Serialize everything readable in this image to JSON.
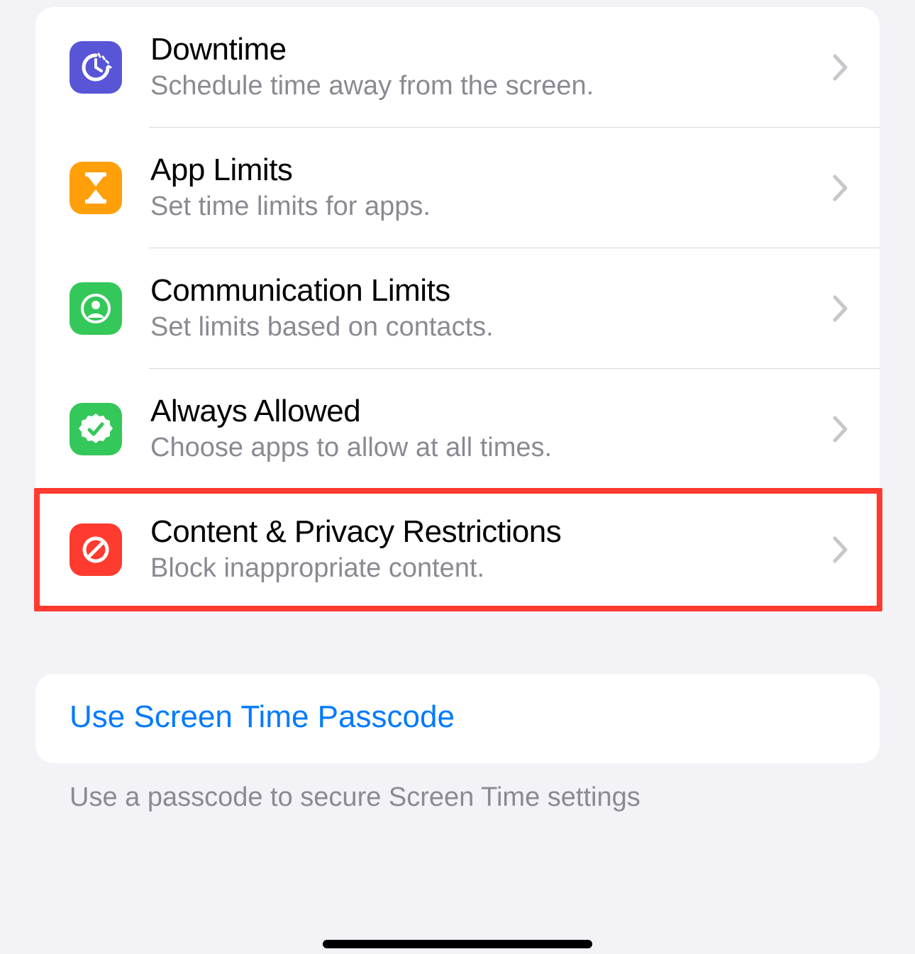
{
  "settings": {
    "items": [
      {
        "title": "Downtime",
        "subtitle": "Schedule time away from the screen.",
        "icon": "clock-sleep-icon",
        "color": "#5856d6"
      },
      {
        "title": "App Limits",
        "subtitle": "Set time limits for apps.",
        "icon": "hourglass-icon",
        "color": "#ff9f0a"
      },
      {
        "title": "Communication Limits",
        "subtitle": "Set limits based on contacts.",
        "icon": "contact-circle-icon",
        "color": "#34c759"
      },
      {
        "title": "Always Allowed",
        "subtitle": "Choose apps to allow at all times.",
        "icon": "check-badge-icon",
        "color": "#34c759"
      },
      {
        "title": "Content & Privacy Restrictions",
        "subtitle": "Block inappropriate content.",
        "icon": "no-symbol-icon",
        "color": "#ff3b30"
      }
    ]
  },
  "passcode": {
    "action": "Use Screen Time Passcode",
    "footer": "Use a passcode to secure Screen Time settings"
  },
  "highlight": {
    "target_item_index": 4
  }
}
